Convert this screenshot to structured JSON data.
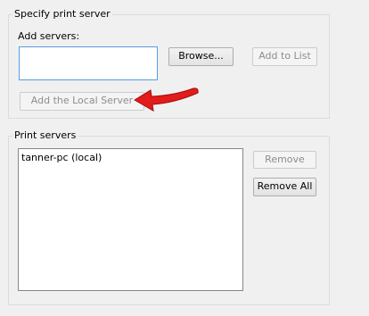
{
  "specify_group": {
    "title": "Specify print server",
    "add_servers_label": "Add servers:",
    "add_servers_value": "",
    "browse_label": "Browse...",
    "add_to_list_label": "Add to List",
    "add_local_label": "Add the Local Server"
  },
  "servers_group": {
    "title": "Print servers",
    "items": [
      "tanner-pc (local)"
    ],
    "remove_label": "Remove",
    "remove_all_label": "Remove All"
  },
  "annotation": {
    "arrow_icon": "red-arrow-icon",
    "color": "#e21b1b"
  }
}
